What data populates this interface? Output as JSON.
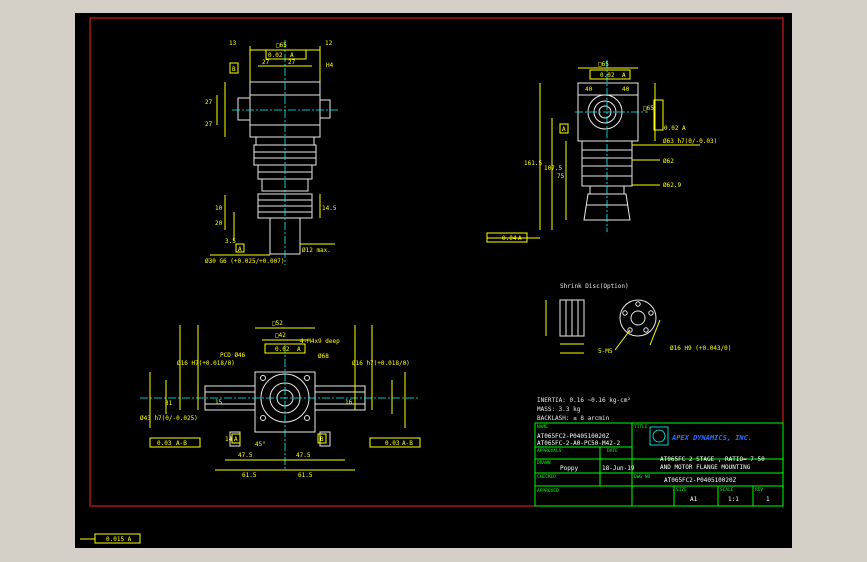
{
  "drawing": {
    "part_number": "AT065FC2-P040510020Z",
    "title_line_1": "AT065FC 2 STAGE , RATIO= 7-50",
    "title_line_2": "AND MOTOR FLANGE MOUNTING",
    "company": "APEX DYNAMICS, INC.",
    "name_1": "AT065FC2-P040510020Z",
    "name_2": "AT065FC-2-A0-PC50-M42-2",
    "drawn_by": "Poppy",
    "date": "18-Jun-19",
    "size": "A1",
    "scale": "1:1",
    "sheet": "1",
    "bottom_tolerance": "0.015 A",
    "labels": {
      "name": "NAME",
      "approvals": "APPROVALS",
      "date": "DATE",
      "title": "TITLE",
      "drawn": "DRAWN",
      "checked": "CHECKED",
      "approved": "APPROVED",
      "dwg_no": "DWG NO",
      "size": "SIZE",
      "scale": "SCALE",
      "rev": "REV"
    }
  },
  "notes": {
    "inertia": "INERTIA: 0.16 ~0.16   kg-cm²",
    "mass": "MASS: 3.3 kg",
    "backlash": "BACKLASH: ≤ 8 arcmin"
  },
  "shrink_disc": {
    "title": "Shrink Disc(Option)",
    "bolt_spec": "5-M5",
    "bore": "Ø16 H9 (+0.043/0)"
  },
  "dims": {
    "top_left": [
      "□65",
      "0.02",
      "A",
      "27",
      "27",
      "27",
      "27",
      "B",
      "H4",
      "13",
      "12",
      "20",
      "10",
      "3.5",
      "14.5",
      "Ø12 max.",
      "Ø30 G6 (+0.025/+0.007)",
      "A"
    ],
    "top_right": [
      "□65",
      "0.02",
      "A",
      "40",
      "40",
      "□65",
      "0.02 A",
      "Ø63 h7(0/-0.03)",
      "Ø62",
      "Ø62.9",
      "161.5",
      "107.5",
      "75",
      "0.04",
      "A",
      "A"
    ],
    "bottom_left": [
      "□52",
      "□42",
      "0.02",
      "A",
      "4-M4x9 deep",
      "PCD Ø46",
      "Ø68",
      "Ø16 H7(+0.018/0)",
      "Ø16 h7(+0.018/0)",
      "Ø43 h7(0/-0.025)",
      "31",
      "15",
      "16",
      "14",
      "45°",
      "47.5",
      "47.5",
      "61.5",
      "61.5",
      "0.03",
      "A-B",
      "0.03",
      "A-B",
      "A",
      "B"
    ]
  }
}
